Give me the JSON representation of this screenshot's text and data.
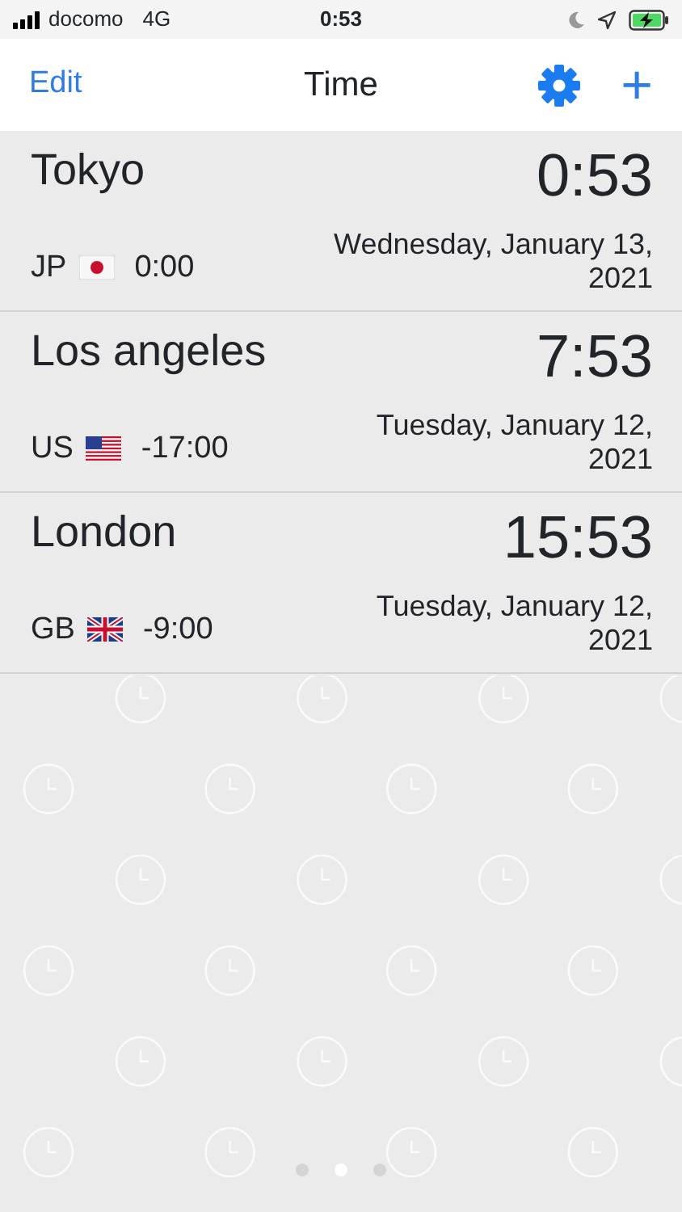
{
  "status_bar": {
    "carrier": "docomo",
    "network": "4G",
    "time": "0:53"
  },
  "nav": {
    "left_button": "Edit",
    "title": "Time",
    "add_button": "+"
  },
  "cities": [
    {
      "name": "Tokyo",
      "country": "JP",
      "flag": {
        "kind": "jp"
      },
      "offset": "0:00",
      "time": "0:53",
      "date": "Wednesday, January 13, 2021"
    },
    {
      "name": "Los angeles",
      "country": "US",
      "flag": {
        "kind": "us"
      },
      "offset": "-17:00",
      "time": "7:53",
      "date": "Tuesday, January 12, 2021"
    },
    {
      "name": "London",
      "country": "GB",
      "flag": {
        "kind": "gb"
      },
      "offset": "-9:00",
      "time": "15:53",
      "date": "Tuesday, January 12, 2021"
    }
  ],
  "page_dots": [
    {
      "selected": false
    },
    {
      "selected": true
    },
    {
      "selected": false
    }
  ]
}
